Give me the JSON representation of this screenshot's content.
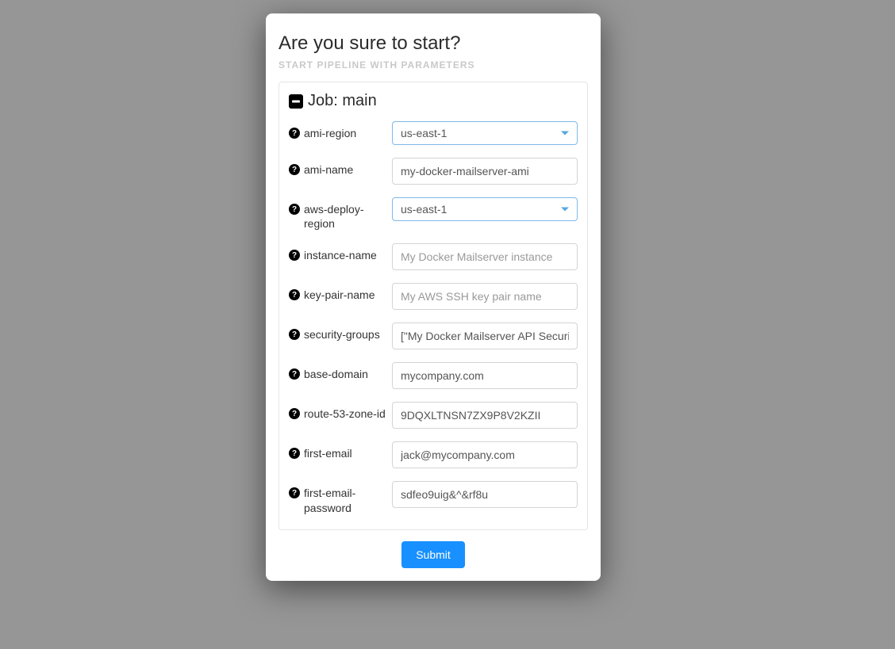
{
  "modal": {
    "title": "Are you sure to start?",
    "subtitle": "START PIPELINE WITH PARAMETERS"
  },
  "job": {
    "header": "Job: main",
    "fields": [
      {
        "label": "ami-region",
        "type": "select",
        "value": "us-east-1"
      },
      {
        "label": "ami-name",
        "type": "text",
        "value": "my-docker-mailserver-ami"
      },
      {
        "label": "aws-deploy-region",
        "type": "select",
        "value": "us-east-1"
      },
      {
        "label": "instance-name",
        "type": "text",
        "value": "",
        "placeholder": "My Docker Mailserver instance"
      },
      {
        "label": "key-pair-name",
        "type": "text",
        "value": "",
        "placeholder": "My AWS SSH key pair name"
      },
      {
        "label": "security-groups",
        "type": "text",
        "value": "[\"My Docker Mailserver API Security Group\"]"
      },
      {
        "label": "base-domain",
        "type": "text",
        "value": "mycompany.com"
      },
      {
        "label": "route-53-zone-id",
        "type": "text",
        "value": "9DQXLTNSN7ZX9P8V2KZII"
      },
      {
        "label": "first-email",
        "type": "text",
        "value": "jack@mycompany.com"
      },
      {
        "label": "first-email-password",
        "type": "text",
        "value": "sdfeo9uig&^&rf8u"
      }
    ]
  },
  "submit_label": "Submit"
}
